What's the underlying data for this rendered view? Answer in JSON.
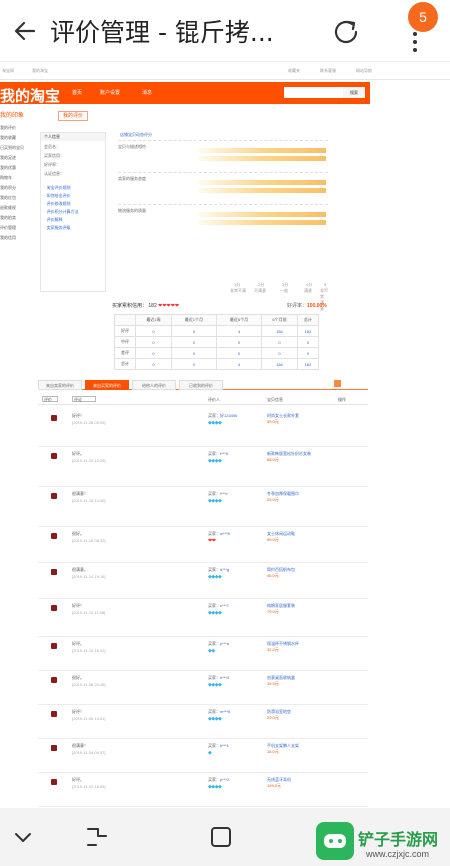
{
  "topbar": {
    "title": "评价管理 - 锟斤拷...",
    "notification_count": "5"
  },
  "site": {
    "logo": "我的淘宝",
    "top_links": [
      "淘宝网",
      "我的淘宝",
      "收藏夹",
      "联系客服",
      "网站导航"
    ],
    "nav": [
      "首页",
      "账户设置",
      "消息"
    ],
    "search_button": "搜索"
  },
  "sidebar": {
    "title": "我的印象",
    "items": [
      "我的评价",
      "我的收藏",
      "已买到的宝贝",
      "我的足迹",
      "我的优惠",
      "购物车",
      "我的积分",
      "我的红包",
      "退款维权",
      "我的拍卖",
      "评价管理",
      "我的信用"
    ]
  },
  "tab_my": "我的评价",
  "profile": {
    "header": "个人信息",
    "rows": [
      "会员名：",
      "买家信用：",
      "好评率：",
      "认证信息："
    ],
    "links": [
      "· 淘宝评价规则",
      "· 如何给出评价",
      "· 评价修改规则",
      "· 评价积分计算方法",
      "· 评价解释",
      "· 卖家服务评级"
    ]
  },
  "ratings": {
    "title": "店铺宝贝动态评分",
    "rows": [
      "宝贝与描述相符",
      "卖家的服务态度",
      "物流服务的质量"
    ],
    "axis": [
      "1分",
      "2分",
      "3分",
      "4分",
      "5分"
    ],
    "axis_labels": [
      "非常不满",
      "不满意",
      "一般",
      "满意",
      "非常满意"
    ]
  },
  "score": {
    "label": "买家累积信用：",
    "value": "182",
    "hearts": "❤❤❤❤❤",
    "rate_label": "好评率：",
    "rate_value": "100.00%"
  },
  "stats": {
    "headers": [
      "",
      "最近1周",
      "最近1个月",
      "最近6个月",
      "6个月前",
      "总计"
    ],
    "rows": [
      [
        "好评",
        "0",
        "0",
        "4",
        "184",
        "182"
      ],
      [
        "中评",
        "0",
        "0",
        "0",
        "0",
        "0"
      ],
      [
        "差评",
        "0",
        "0",
        "0",
        "0",
        "0"
      ],
      [
        "总计",
        "0",
        "0",
        "4",
        "184",
        "182"
      ]
    ]
  },
  "subtabs": [
    "来自卖家的评价",
    "来自买家的评价",
    "给他人的评价",
    "已收到的评价"
  ],
  "list_head": {
    "filter1": "评价",
    "filter2": "评论",
    "col_buyer": "评价人",
    "col_item": "宝贝信息",
    "col_op": "操作"
  },
  "reviews": [
    {
      "text": "好评！",
      "date": "[2019-11-26 09:09]",
      "buyer": "买家：",
      "buyer_name": "好123456",
      "level": "◆◆◆◆",
      "item": "时尚女士长款外套",
      "price": "39.0元"
    },
    {
      "text": "好评。",
      "date": "[2019-11-20 10:25]",
      "buyer": "买家：",
      "buyer_name": "t***5",
      "level": "◆◆◆◆",
      "item": "新款韩版宽松针织衫女装",
      "price": "68.0元"
    },
    {
      "text": "很满意！",
      "date": "[2019-11-18 14:40]",
      "buyer": "买家：",
      "buyer_name": "l***x",
      "level": "◆◆◆◆",
      "item": "冬季加厚保暖围巾",
      "price": "25.0元"
    },
    {
      "text": "很好。",
      "date": "[2019-11-16 08:32]",
      "buyer": "买家：",
      "buyer_name": "w***8",
      "level": "❤❤",
      "item": "女士休闲运动鞋",
      "price": "99.0元"
    },
    {
      "text": "很满意。",
      "date": "[2019-11-14 19:16]",
      "buyer": "买家：",
      "buyer_name": "d***g",
      "level": "◆◆◆◆",
      "item": "简约百搭帆布包",
      "price": "45.0元"
    },
    {
      "text": "好评！",
      "date": "[2019-11-12 11:08]",
      "buyer": "买家：",
      "buyer_name": "c***7",
      "level": "◆◆◆◆",
      "item": "纯棉家居服套装",
      "price": "79.0元"
    },
    {
      "text": "好评。",
      "date": "[2019-11-10 16:22]",
      "buyer": "买家：",
      "buyer_name": "y***a",
      "level": "◆◆",
      "item": "保温杯不锈钢水杯",
      "price": "32.0元"
    },
    {
      "text": "很好。",
      "date": "[2019-11-08 20:45]",
      "buyer": "买家：",
      "buyer_name": "h***3",
      "level": "◆◆◆◆",
      "item": "创意桌面收纳盒",
      "price": "19.9元"
    },
    {
      "text": "好评！",
      "date": "[2019-11-06 13:51]",
      "buyer": "买家：",
      "buyer_name": "m***6",
      "level": "◆◆◆◆",
      "item": "防滑浴室地垫",
      "price": "29.0元"
    },
    {
      "text": "很满意！",
      "date": "[2019-11-04 09:37]",
      "buyer": "买家：",
      "buyer_name": "k***1",
      "level": "◆",
      "item": "手机支架懒人支架",
      "price": "15.0元"
    },
    {
      "text": "好评。",
      "date": "[2019-11-02 18:05]",
      "buyer": "买家：",
      "buyer_name": "p***2",
      "level": "◆◆◆◆",
      "item": "无线蓝牙耳机",
      "price": "129.0元"
    },
    {
      "text": "很好。",
      "date": "[2019-10-31 15:29]",
      "buyer": "买家：",
      "buyer_name": "s***9",
      "level": "❤❤❤❤",
      "item": "秋冬加绒打底裤",
      "price": "49.0元"
    }
  ],
  "watermark": {
    "title": "铲子手游网",
    "url": "www.czjxjc.com"
  },
  "colors": {
    "brand": "#ff5000",
    "link": "#3366cc",
    "badge": "#f56a1f",
    "watermark_green": "#2cb55a"
  }
}
